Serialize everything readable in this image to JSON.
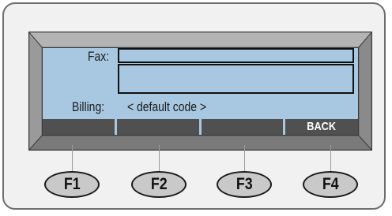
{
  "screen": {
    "fax_label": "Fax:",
    "fax_value_line1": "",
    "fax_value_line2": "",
    "billing_label": "Billing:",
    "billing_value": "< default code >"
  },
  "softkeys": [
    "",
    "",
    "",
    "BACK"
  ],
  "function_keys": [
    "F1",
    "F2",
    "F3",
    "F4"
  ],
  "colors": {
    "screen_background": "#a8c8e2",
    "softkey_bar": "#505050",
    "bezel": "#7a7a7a",
    "key_face": "#c9c9c9"
  }
}
